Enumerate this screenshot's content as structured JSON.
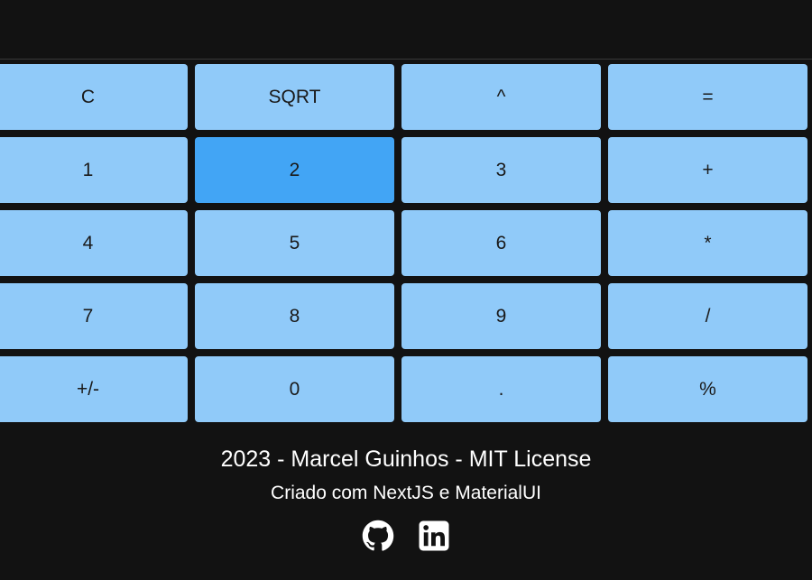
{
  "display": {
    "value": ""
  },
  "keypad": {
    "keys": [
      {
        "label": "C"
      },
      {
        "label": "SQRT"
      },
      {
        "label": "^"
      },
      {
        "label": "="
      },
      {
        "label": "1"
      },
      {
        "label": "2"
      },
      {
        "label": "3"
      },
      {
        "label": "+"
      },
      {
        "label": "4"
      },
      {
        "label": "5"
      },
      {
        "label": "6"
      },
      {
        "label": "*"
      },
      {
        "label": "7"
      },
      {
        "label": "8"
      },
      {
        "label": "9"
      },
      {
        "label": "/"
      },
      {
        "label": "+/-"
      },
      {
        "label": "0"
      },
      {
        "label": "."
      },
      {
        "label": "%"
      }
    ],
    "highlighted_key": "2"
  },
  "footer": {
    "credits": "2023 - Marcel Guinhos - MIT License",
    "built_with": "Criado com NextJS e MaterialUI",
    "links": [
      {
        "icon": "github-icon"
      },
      {
        "icon": "linkedin-icon"
      }
    ]
  },
  "colors": {
    "background": "#121212",
    "key": "#90caf9",
    "key_active": "#42a5f5",
    "text_light": "#ffffff",
    "key_text": "#1a1a1a"
  }
}
